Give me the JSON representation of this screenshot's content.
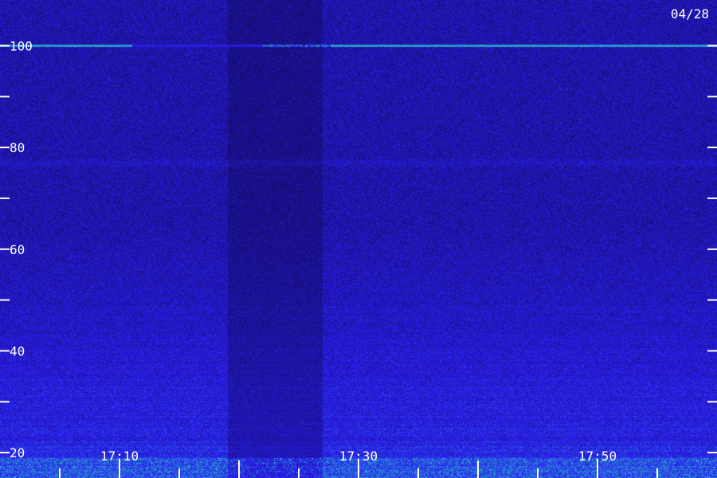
{
  "date_label": "04/28",
  "chart_data": {
    "type": "heatmap",
    "title": "",
    "xlabel": "",
    "ylabel": "",
    "x_tick_labels": [
      "17:10",
      "17:30",
      "17:50"
    ],
    "y_tick_labels": [
      "20",
      "40",
      "60",
      "80",
      "100"
    ],
    "x_range": [
      "17:00",
      "18:00"
    ],
    "y_range": [
      15,
      109
    ],
    "gap_times": [
      "17:19",
      "17:27"
    ],
    "strong_line_frequency": 100,
    "weak_band_frequency": 77,
    "strong_band_frequency": 18,
    "colors": {
      "background": "#0f0860",
      "mid": "#2b2ae8",
      "strong": "#24e8a8",
      "text": "#ffffff"
    }
  }
}
